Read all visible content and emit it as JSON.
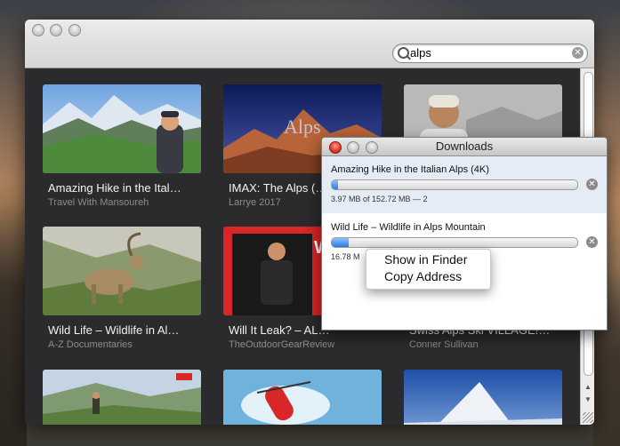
{
  "search": {
    "value": "alps"
  },
  "videos": [
    {
      "title": "Amazing Hike in the Ital…",
      "channel": "Travel With Mansoureh"
    },
    {
      "title": "IMAX: The Alps (…",
      "channel": "Larrye 2017"
    },
    {
      "title": "",
      "channel": ""
    },
    {
      "title": "Wild Life – Wildlife in Al…",
      "channel": "A-Z Documentaries"
    },
    {
      "title": "Will It Leak? – AL…",
      "channel": "TheOutdoorGearReview"
    },
    {
      "title": "Swiss Alps Ski VILLAGE!…",
      "channel": "Conner Sullivan"
    },
    {
      "title": "",
      "channel": ""
    },
    {
      "title": "",
      "channel": ""
    },
    {
      "title": "",
      "channel": ""
    }
  ],
  "thumb_text": {
    "imax": "Alps",
    "will": "Will"
  },
  "downloads": {
    "title": "Downloads",
    "items": [
      {
        "name": "Amazing Hike in the Italian Alps (4K)",
        "status": "3.97 MB of 152.72 MB — 2",
        "progress": 0.026
      },
      {
        "name": "Wild Life – Wildlife in Alps Mountain",
        "status": "16.78 M",
        "progress": 0.07
      }
    ]
  },
  "context_menu": {
    "items": [
      "Show in Finder",
      "Copy Address"
    ]
  },
  "colors": {
    "accent": "#2a78e6",
    "close_red": "#e0362a"
  }
}
